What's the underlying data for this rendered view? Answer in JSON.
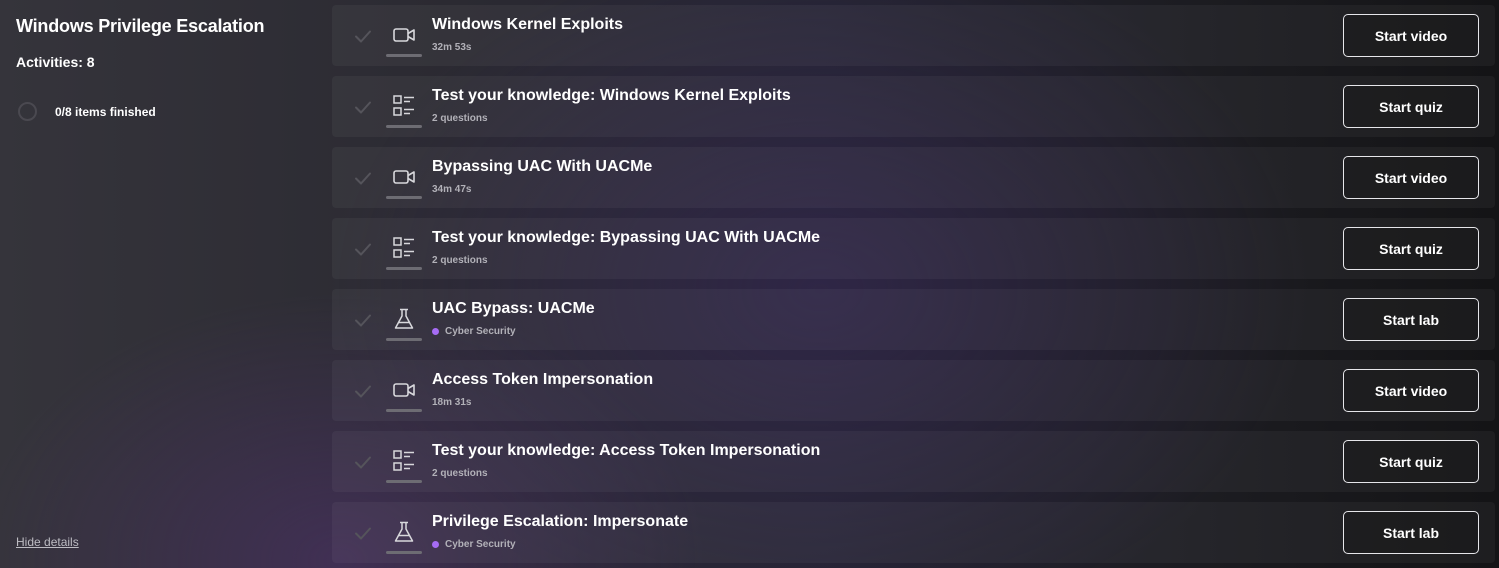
{
  "sidebar": {
    "title": "Windows Privilege Escalation",
    "activities": "Activities: 8",
    "progress_text": "0/8 items finished",
    "hide_details": "Hide details"
  },
  "accent_color": "#a66cf4",
  "items": [
    {
      "type_icon": "video-camera-icon",
      "title": "Windows Kernel Exploits",
      "subtitle": "32m 53s",
      "action": "Start video"
    },
    {
      "type_icon": "quiz-list-icon",
      "title": "Test your knowledge: Windows Kernel Exploits",
      "subtitle": "2 questions",
      "action": "Start quiz"
    },
    {
      "type_icon": "video-camera-icon",
      "title": "Bypassing UAC With UACMe",
      "subtitle": "34m 47s",
      "action": "Start video"
    },
    {
      "type_icon": "quiz-list-icon",
      "title": "Test your knowledge: Bypassing UAC With UACMe",
      "subtitle": "2 questions",
      "action": "Start quiz"
    },
    {
      "type_icon": "lab-flask-icon",
      "title": "UAC Bypass: UACMe",
      "subtitle": "Cyber Security",
      "action": "Start lab"
    },
    {
      "type_icon": "video-camera-icon",
      "title": "Access Token Impersonation",
      "subtitle": "18m 31s",
      "action": "Start video"
    },
    {
      "type_icon": "quiz-list-icon",
      "title": "Test your knowledge: Access Token Impersonation",
      "subtitle": "2 questions",
      "action": "Start quiz"
    },
    {
      "type_icon": "lab-flask-icon",
      "title": "Privilege Escalation: Impersonate",
      "subtitle": "Cyber Security",
      "action": "Start lab"
    }
  ]
}
